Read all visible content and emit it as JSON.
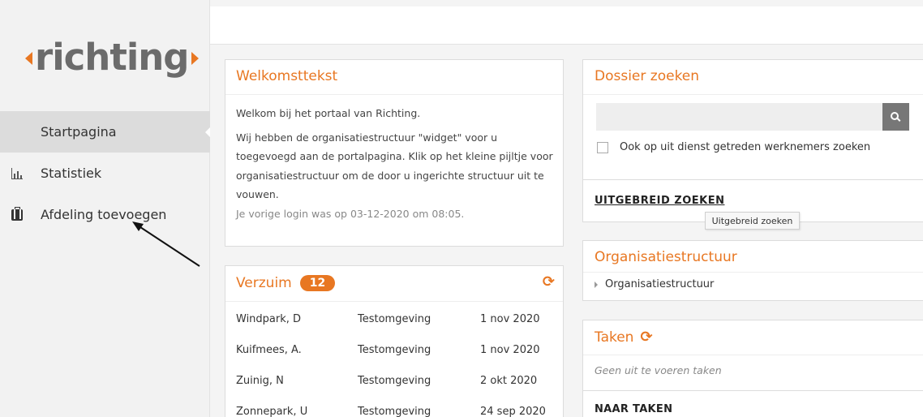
{
  "sidebar": {
    "logo": "richting",
    "items": [
      {
        "label": "Startpagina",
        "icon": "home"
      },
      {
        "label": "Statistiek",
        "icon": "bar-chart-icon"
      },
      {
        "label": "Afdeling toevoegen",
        "icon": "briefcase-icon"
      }
    ]
  },
  "welkom": {
    "title": "Welkomsttekst",
    "line1": "Welkom bij het portaal van Richting.",
    "line2": "Wij hebben de organisatiestructuur \"widget\" voor u toegevoegd aan de portalpagina. Klik op het kleine pijltje voor organisatiestructuur om de door u ingerichte structuur uit te vouwen.",
    "last_login": "Je vorige login was op 03-12-2020 om 08:05."
  },
  "verzuim": {
    "title": "Verzuim",
    "count": "12",
    "rows": [
      {
        "name": "Windpark, D",
        "env": "Testomgeving",
        "date": "1 nov 2020"
      },
      {
        "name": "Kuifmees, A.",
        "env": "Testomgeving",
        "date": "1 nov 2020"
      },
      {
        "name": "Zuinig, N",
        "env": "Testomgeving",
        "date": "2 okt 2020"
      },
      {
        "name": "Zonnepark, U",
        "env": "Testomgeving",
        "date": "24 sep 2020"
      }
    ]
  },
  "dossier": {
    "title": "Dossier zoeken",
    "search_value": "",
    "checkbox_label": "Ook op uit dienst getreden werknemers zoeken",
    "advanced_link": "UITGEBREID ZOEKEN",
    "tooltip": "Uitgebreid zoeken"
  },
  "org": {
    "title": "Organisatiestructuur",
    "item": "Organisatiestructuur"
  },
  "taken": {
    "title": "Taken",
    "empty": "Geen uit te voeren taken",
    "link": "NAAR TAKEN"
  },
  "colors": {
    "accent": "#e87722",
    "sidebar_bg": "#f2f2f2"
  }
}
